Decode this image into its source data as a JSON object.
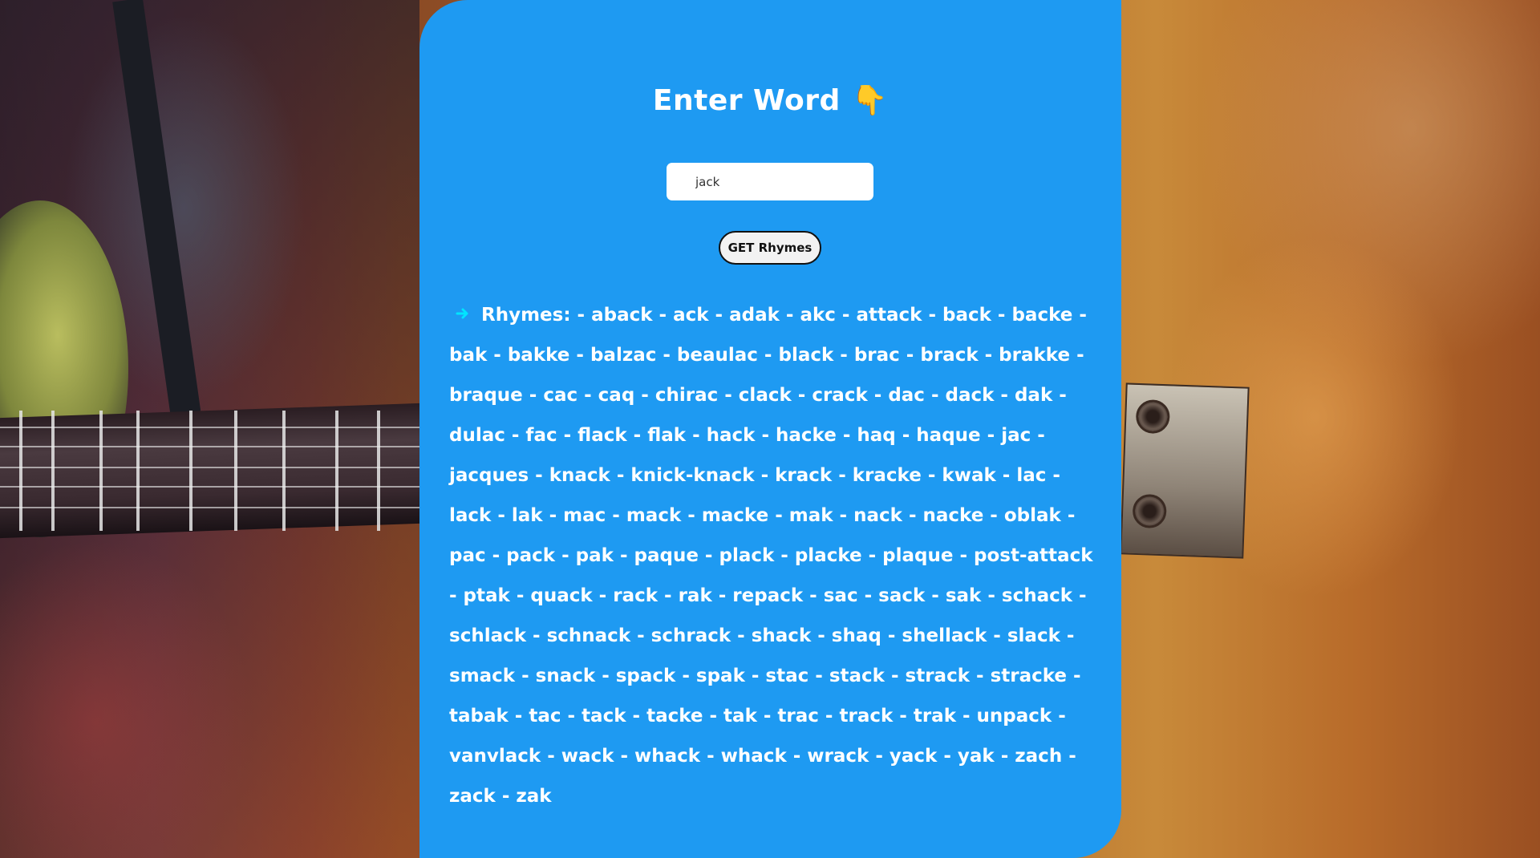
{
  "header": {
    "title": "Enter Word",
    "hand_emoji": "👇"
  },
  "search": {
    "value": "jack"
  },
  "actions": {
    "get_label": "GET Rhymes"
  },
  "results": {
    "label": "Rhymes:",
    "text": "- aback - ack - adak - akc - attack - back - backe - bak - bakke - balzac - beaulac - black - brac - brack - brakke - braque - cac - caq - chirac - clack - crack - dac - dack - dak - dulac - fac - flack - flak - hack - hacke - haq - haque - jac - jacques - knack - knick-knack - krack - kracke - kwak - lac - lack - lak - mac - mack - macke - mak - nack - nacke - oblak - pac - pack - pak - paque - plack - placke - plaque - post-attack - ptak - quack - rack - rak - repack - sac - sack - sak - schack - schlack - schnack - schrack - shack - shaq - shellack - slack - smack - snack - spack - spak - stac - stack - strack - stracke - tabak - tac - tack - tacke - tak - trac - track - trak - unpack - vanvlack - wack - whack - whack - wrack - yack - yak - zach - zack - zak",
    "arrow_icon": "arrow-right-icon"
  },
  "colors": {
    "card": "#1e9af2",
    "arrow": "#00e5ff"
  }
}
